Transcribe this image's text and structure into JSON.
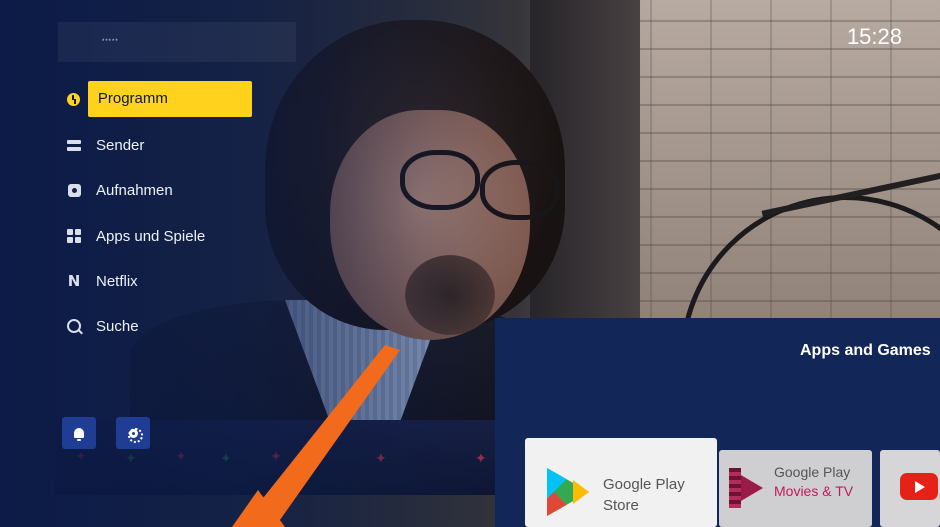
{
  "header": {
    "logo_text": "*****",
    "clock": "15:28"
  },
  "menu": {
    "items": [
      {
        "label": "Programm",
        "icon": "clock-icon",
        "active": true
      },
      {
        "label": "Sender",
        "icon": "channel-list-icon"
      },
      {
        "label": "Aufnahmen",
        "icon": "record-icon"
      },
      {
        "label": "Apps und Spiele",
        "icon": "apps-grid-icon"
      },
      {
        "label": "Netflix",
        "icon": "netflix-n-icon"
      },
      {
        "label": "Suche",
        "icon": "search-icon"
      }
    ]
  },
  "bottom_buttons": {
    "notifications": "bell-icon",
    "settings": "gear-icon"
  },
  "apps_panel": {
    "title": "Apps and Games",
    "cards": [
      {
        "line1": "Google Play",
        "line2": "Store",
        "icon": "google-play-store-icon"
      },
      {
        "line1": "Google Play",
        "line2": "Movies & TV",
        "icon": "google-play-movies-icon"
      },
      {
        "line1": "",
        "line2": "",
        "icon": "youtube-icon"
      }
    ]
  },
  "colors": {
    "accent": "#ffd21e",
    "panel": "#122657",
    "button": "#1f3e93",
    "arrow": "#f26a1b",
    "movies_text": "#c2185b"
  }
}
